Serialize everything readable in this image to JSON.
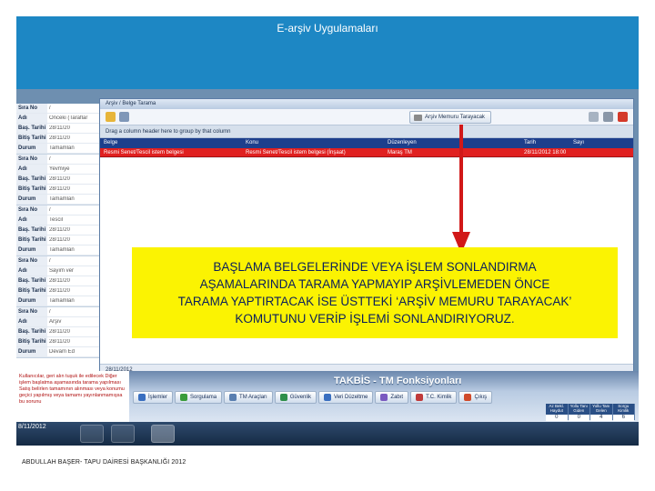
{
  "title": "E-arşiv Uygulamaları",
  "window": {
    "title": "Arşiv / Belge Tarama",
    "tarayacak_button": "Arşiv Memuru Tarayacak",
    "group_hint": "Drag a column header here to group by that column",
    "columns": [
      "Belge",
      "Konu",
      "Düzenleyen",
      "Tarih",
      "Sayı"
    ],
    "selected_row": [
      "Resmi Senet/Tescil istem belgesi",
      "Resmi Senet/Tescil istem belgesi (İnşaat)",
      "Maraş TM",
      "28/11/2012 18:00",
      ""
    ],
    "status_date": "28/11/2012"
  },
  "left_panel": {
    "records": [
      {
        "rows": [
          [
            "Sıra No",
            "/"
          ],
          [
            "Adı",
            "Önceki (Taraflar"
          ],
          [
            "Baş. Tarihi",
            "28/11/20"
          ],
          [
            "Bitiş Tarihi",
            "28/11/20"
          ],
          [
            "Durum",
            "Tamamlan"
          ]
        ]
      },
      {
        "rows": [
          [
            "Sıra No",
            "/"
          ],
          [
            "Adı",
            "Yevmiye"
          ],
          [
            "Baş. Tarihi",
            "28/11/20"
          ],
          [
            "Bitiş Tarihi",
            "28/11/20"
          ],
          [
            "Durum",
            "Tamamlan"
          ]
        ]
      },
      {
        "rows": [
          [
            "Sıra No",
            "/"
          ],
          [
            "Adı",
            "Tescil"
          ],
          [
            "Baş. Tarihi",
            "28/11/20"
          ],
          [
            "Bitiş Tarihi",
            "28/11/20"
          ],
          [
            "Durum",
            "Tamamlan"
          ]
        ]
      },
      {
        "rows": [
          [
            "Sıra No",
            "/"
          ],
          [
            "Adı",
            "Sayım ver"
          ],
          [
            "Baş. Tarihi",
            "28/11/20"
          ],
          [
            "Bitiş Tarihi",
            "28/11/20"
          ],
          [
            "Durum",
            "Tamamlan"
          ]
        ]
      },
      {
        "rows": [
          [
            "Sıra No",
            "/"
          ],
          [
            "Adı",
            "Arşiv"
          ],
          [
            "Baş. Tarihi",
            "28/11/20"
          ],
          [
            "Bitiş Tarihi",
            "28/11/20"
          ],
          [
            "Durum",
            "Devam Ed"
          ]
        ]
      }
    ]
  },
  "callout": {
    "lines": [
      "BAŞLAMA BELGELERİNDE VEYA İŞLEM SONLANDIRMA",
      "AŞAMALARINDA TARAMA YAPMAYIP ARŞİVLEMEDEN ÖNCE",
      "TARAMA YAPTIRTACAK İSE ÜSTTEKİ ‘ARŞİV MEMURU TARAYACAK’",
      "KOMUTUNU VERİP İŞLEMİ SONLANDIRIYORUZ."
    ]
  },
  "takbis": {
    "title": "TAKBİS - TM Fonksiyonları",
    "notice": "Kullanıcılar, geri alın tuşuk ile edilecek Diğer işlem başlatma aşamasında tarama yapılması Satış belirlen tamamının alınması veya konumu geçici yapılmış veya tamamı yayınlanmamışsa bu sorunu",
    "menu": [
      "İşlemler",
      "Sorgulama",
      "TM Araçları",
      "Güvenlik",
      "Veri Düzeltme",
      "Zabıt",
      "T.C. Kimlik",
      "Çıkış"
    ],
    "stats": [
      {
        "label": "Az Bekl. Haydut",
        "value": "0"
      },
      {
        "label": "Yollu Tanı Giden",
        "value": "0"
      },
      {
        "label": "Yollu Tanı Gelen",
        "value": "4"
      },
      {
        "label": "Sorgu Kimlik",
        "value": "6"
      }
    ]
  },
  "taskbar": {
    "date": "8/11/2012"
  },
  "footer": "ABDULLAH BAŞER- TAPU DAİRESİ BAŞKANLIĞI 2012",
  "colors": {
    "title_band": "#1d87c4",
    "callout_bg": "#fbf302",
    "callout_text": "#0a1f5c",
    "selected_row": "#e02020",
    "arrow": "#d11818"
  }
}
